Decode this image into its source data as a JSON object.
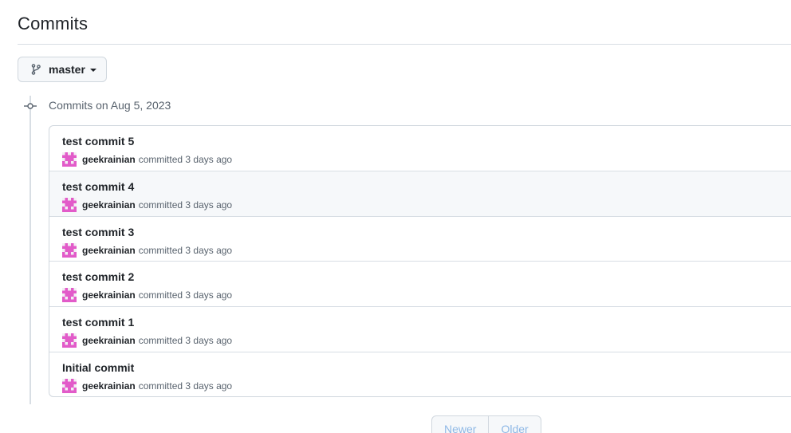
{
  "page": {
    "title": "Commits"
  },
  "branch_selector": {
    "label": "master",
    "icon": "git-branch-icon"
  },
  "commit_group": {
    "heading": "Commits on Aug 5, 2023",
    "commits": [
      {
        "title": "test commit 5",
        "author": "geekrainian",
        "meta": "committed 3 days ago"
      },
      {
        "title": "test commit 4",
        "author": "geekrainian",
        "meta": "committed 3 days ago"
      },
      {
        "title": "test commit 3",
        "author": "geekrainian",
        "meta": "committed 3 days ago"
      },
      {
        "title": "test commit 2",
        "author": "geekrainian",
        "meta": "committed 3 days ago"
      },
      {
        "title": "test commit 1",
        "author": "geekrainian",
        "meta": "committed 3 days ago"
      },
      {
        "title": "Initial commit",
        "author": "geekrainian",
        "meta": "committed 3 days ago"
      }
    ]
  },
  "pagination": {
    "newer": "Newer",
    "older": "Older"
  },
  "colors": {
    "avatar": "#e25bc9",
    "pagination_text": "#8eb8e6",
    "hover_row": "#f6f8fa"
  }
}
